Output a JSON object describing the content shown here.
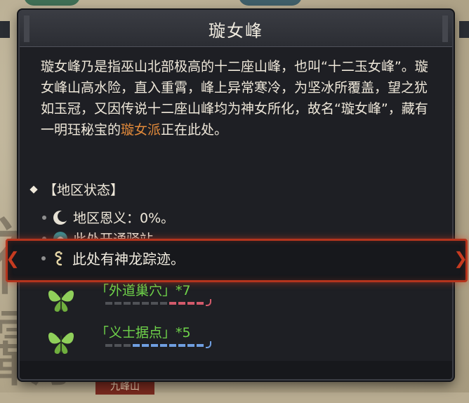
{
  "window": {
    "title": "璇女峰"
  },
  "description": {
    "before": "璇女峰乃是指巫山北部极高的十二座山峰，也叫“十二玉女峰”。璇女峰山高水险，直入重霄，峰上异常寒冷，为坚冰所覆盖，望之犹如玉冠，又因传说十二座山峰均为神女所化，故名“璇女峰”，藏有一明珏秘宝的",
    "highlight": "璇女派",
    "after": "正在此处。"
  },
  "section": {
    "heading": "【地区状态】"
  },
  "status": [
    {
      "text": "地区恩义：0%。",
      "icon": "moon-icon"
    },
    {
      "text": "此处开通驿站。",
      "icon": "waystation-icon"
    },
    {
      "text": "此处有神龙踪迹。",
      "icon": "dragon-icon"
    }
  ],
  "factions": [
    {
      "name": "「外道巢穴」",
      "count": "*7",
      "icon": "green-butterfly-icon",
      "bar_color": "#d25a6a",
      "filled_segments": 4,
      "total_segments": 11
    },
    {
      "name": "「义士据点」",
      "count": "*5",
      "icon": "green-butterfly-icon",
      "bar_color": "#6f9ee0",
      "filled_segments": 8,
      "total_segments": 11
    }
  ],
  "map": {
    "bottom_tag": "九峰山"
  },
  "colors": {
    "highlight": "#e38a3a",
    "faction_name": "#6fd34a",
    "band_border": "#b3341d"
  }
}
